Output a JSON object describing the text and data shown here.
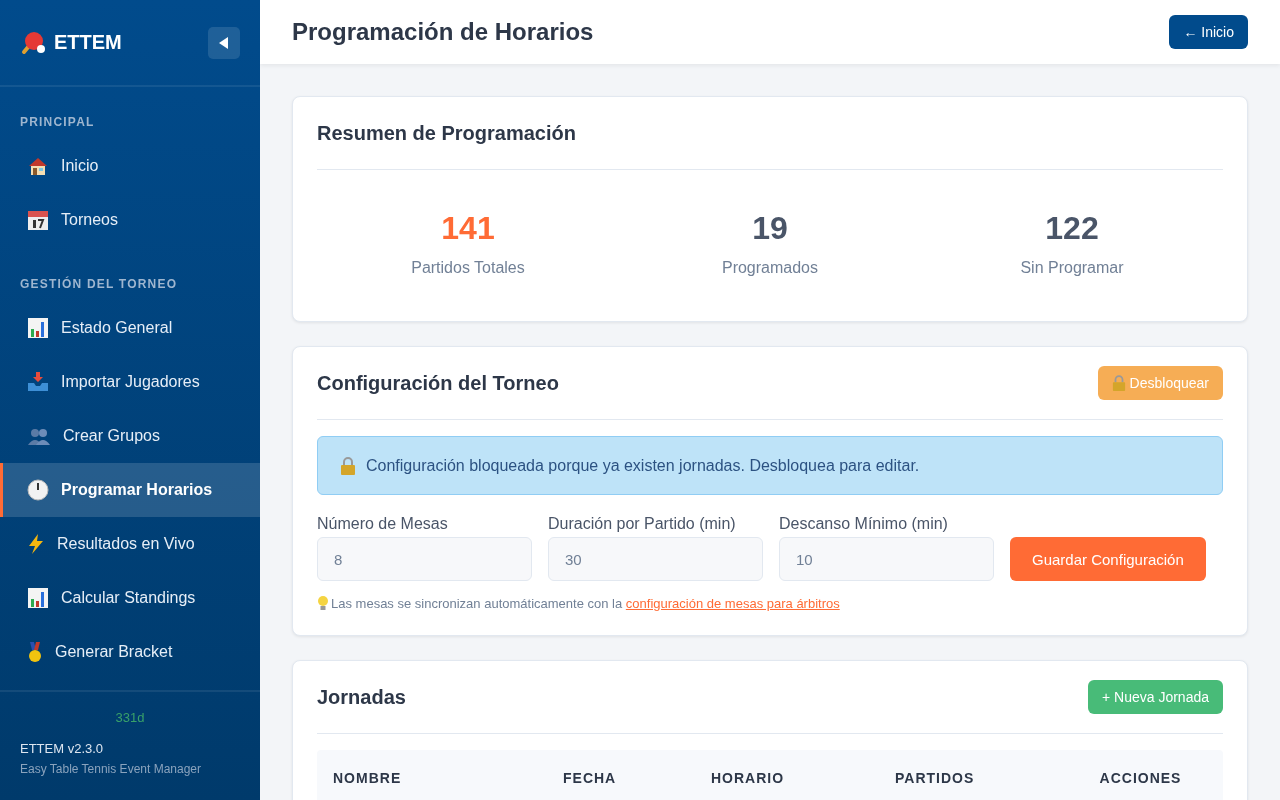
{
  "sidebar": {
    "brand": "ETTEM",
    "sections": [
      {
        "title": "PRINCIPAL",
        "items": [
          {
            "label": "Inicio",
            "selected": false
          },
          {
            "label": "Torneos",
            "selected": false
          }
        ]
      },
      {
        "title": "GESTIÓN DEL TORNEO",
        "items": [
          {
            "label": "Estado General",
            "selected": false
          },
          {
            "label": "Importar Jugadores",
            "selected": false
          },
          {
            "label": "Crear Grupos",
            "selected": false
          },
          {
            "label": "Programar Horarios",
            "selected": true
          },
          {
            "label": "Resultados en Vivo",
            "selected": false
          },
          {
            "label": "Calcular Standings",
            "selected": false
          },
          {
            "label": "Generar Bracket",
            "selected": false
          }
        ]
      }
    ],
    "footer": {
      "badge": "331d",
      "version": "ETTEM v2.3.0",
      "subtitle": "Easy Table Tennis Event Manager"
    }
  },
  "header": {
    "title": "Programación de Horarios",
    "button": "← Inicio"
  },
  "summary": {
    "title": "Resumen de Programación",
    "stats": [
      {
        "value": "141",
        "label": "Partidos Totales",
        "color": "#ff6b35"
      },
      {
        "value": "19",
        "label": "Programados",
        "color": "#4a5568"
      },
      {
        "value": "122",
        "label": "Sin Programar",
        "color": "#4a5568"
      }
    ]
  },
  "config": {
    "title": "Configuración del Torneo",
    "unlock_button": "Desbloquear",
    "locked": true,
    "alert": "Configuración bloqueada porque ya existen jornadas. Desbloquea para editar.",
    "fields": [
      {
        "label": "Número de Mesas",
        "value": "8"
      },
      {
        "label": "Duración por Partido (min)",
        "value": "30"
      },
      {
        "label": "Descanso Mínimo (min)",
        "value": "10"
      }
    ],
    "save_button": "Guardar Configuración",
    "hint": "Las mesas se sincronizan automáticamente con la",
    "hint_link": "configuración de mesas para árbitros"
  },
  "jornadas": {
    "title": "Jornadas",
    "new_button": "+ Nueva Jornada",
    "columns": [
      "NOMBRE",
      "FECHA",
      "HORARIO",
      "PARTIDOS",
      "ACCIONES"
    ]
  }
}
